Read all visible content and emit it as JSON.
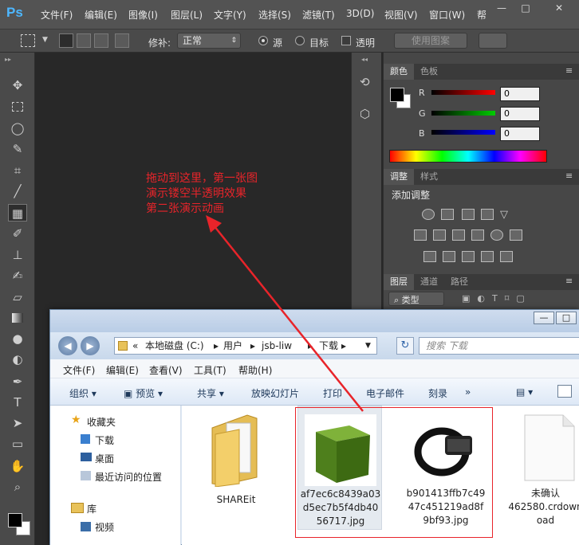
{
  "photoshop": {
    "logo": "Ps",
    "menus": [
      "文件(F)",
      "编辑(E)",
      "图像(I)",
      "图层(L)",
      "文字(Y)",
      "选择(S)",
      "滤镜(T)",
      "3D(D)",
      "视图(V)",
      "窗口(W)",
      "帮"
    ],
    "window_controls": [
      "—",
      "□",
      "✕"
    ],
    "options": {
      "repair_label": "修补:",
      "repair_value": "正常",
      "source_label": "源",
      "target_label": "目标",
      "transparent_label": "透明",
      "use_pattern_label": "使用图案"
    },
    "tools": [
      "move-tool",
      "marquee-tool",
      "lasso-tool",
      "quick-select-tool",
      "crop-tool",
      "eyedropper-tool",
      "patch-tool",
      "brush-tool",
      "stamp-tool",
      "history-brush-tool",
      "eraser-tool",
      "gradient-tool",
      "blur-tool",
      "dodge-tool",
      "pen-tool",
      "type-tool",
      "path-select-tool",
      "shape-tool",
      "hand-tool",
      "zoom-tool"
    ],
    "annotation_lines": [
      "拖动到这里，第一张图",
      "演示镂空半透明效果",
      "第二张演示动画"
    ],
    "annotation_color": "#e8242a"
  },
  "color_panel": {
    "tabs": [
      "颜色",
      "色板"
    ],
    "channels": [
      {
        "label": "R",
        "value": "0"
      },
      {
        "label": "G",
        "value": "0"
      },
      {
        "label": "B",
        "value": "0"
      }
    ]
  },
  "adjust_panel": {
    "tabs": [
      "调整",
      "样式"
    ],
    "title": "添加调整"
  },
  "layers_panel": {
    "tabs": [
      "图层",
      "通道",
      "路径"
    ],
    "filter_label": "类型"
  },
  "explorer": {
    "address": {
      "parts": [
        "本地磁盘 (C:)",
        "用户",
        "jsb-liw",
        "下载"
      ],
      "prefix": "«"
    },
    "search_placeholder": "搜索 下载",
    "menus": [
      "文件(F)",
      "编辑(E)",
      "查看(V)",
      "工具(T)",
      "帮助(H)"
    ],
    "commands": [
      "组织",
      "预览",
      "共享",
      "放映幻灯片",
      "打印",
      "电子邮件",
      "刻录",
      "»"
    ],
    "nav": {
      "favorites": "收藏夹",
      "favorites_items": [
        "下载",
        "桌面",
        "最近访问的位置"
      ],
      "libraries": "库",
      "library_items": [
        "视频"
      ]
    },
    "files": [
      {
        "name_lines": [
          "SHAREit"
        ],
        "type": "folder"
      },
      {
        "name_lines": [
          "af7ec6c8439a03",
          "d5ec7b5f4db40",
          "56717.jpg"
        ],
        "type": "image-green-cube",
        "selected": true
      },
      {
        "name_lines": [
          "b901413ffb7c49",
          "47c451219ad8f",
          "9bf93.jpg"
        ],
        "type": "image-watch"
      },
      {
        "name_lines": [
          "未确认",
          "462580.crdown",
          "oad"
        ],
        "type": "blank-file"
      }
    ]
  }
}
